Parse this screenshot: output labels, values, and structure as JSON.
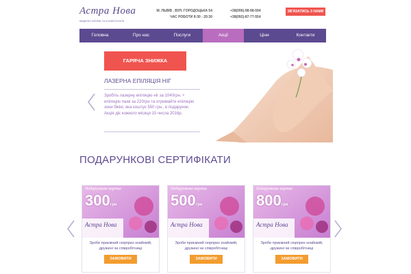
{
  "header": {
    "logo_text": "Астра Нова",
    "logo_tagline": "медичні клініки та косметологія",
    "address": "М. ЛЬВІВ , ВУЛ. ГОРОДОЦЬКА 54",
    "hours": "ЧАС РОБОТИ 8:30 - 20:30",
    "phone1": "+38(096)-98-98-594",
    "phone2": "+38(092)-87-77-554",
    "cta_label": "ЗВ'ЯЗАТИСЬ З НАМИ"
  },
  "nav": {
    "items": [
      "Головна",
      "Про нас",
      "Послуги",
      "Акції",
      "Ціни",
      "Контакти"
    ],
    "active_index": 3
  },
  "promo": {
    "button_label": "ГАРЯЧА ЗНИЖКА",
    "title": "ЛАЗЕРНА ЕПІЛЯЦІЯ НІГ",
    "text": "Зробіть лазерну епіляцію ніг за 1040грн. + епіляцію пахв за 220грн та отримайте епіляцію зони бікіні, яка коштує 550 грн., в подарунок. Акція діє кожного місяця 15 числа 2016р."
  },
  "certificates": {
    "title": "ПОДАРУНКОВІ СЕРТИФІКАТИ",
    "cards": [
      {
        "label": "Подарункова картка",
        "amount": "300",
        "currency": "грн",
        "brand": "Астра Нова",
        "text": "Зроби приємний сюрприз знайомій, дружині чи співробітниці",
        "button": "ЗАМОВИТИ"
      },
      {
        "label": "Подарункова картка",
        "amount": "500",
        "currency": "грн",
        "brand": "Астра Нова",
        "text": "Зроби приємний сюрприз знайомій, дружині чи співробітниці",
        "button": "ЗАМОВИТИ"
      },
      {
        "label": "Подарункова картка",
        "amount": "800",
        "currency": "грн",
        "brand": "Астра Нова",
        "text": "Зроби приємний сюрприз знайомій, дружині чи співробітниці",
        "button": "ЗАМОВИТИ"
      }
    ]
  },
  "colors": {
    "brand_purple": "#5c4a90",
    "accent_pink": "#b96dbe",
    "accent_red": "#f0544f",
    "accent_orange": "#f39c2f"
  },
  "icons": [
    "chevron-left-icon",
    "chevron-right-icon",
    "logo-mark-icon"
  ]
}
